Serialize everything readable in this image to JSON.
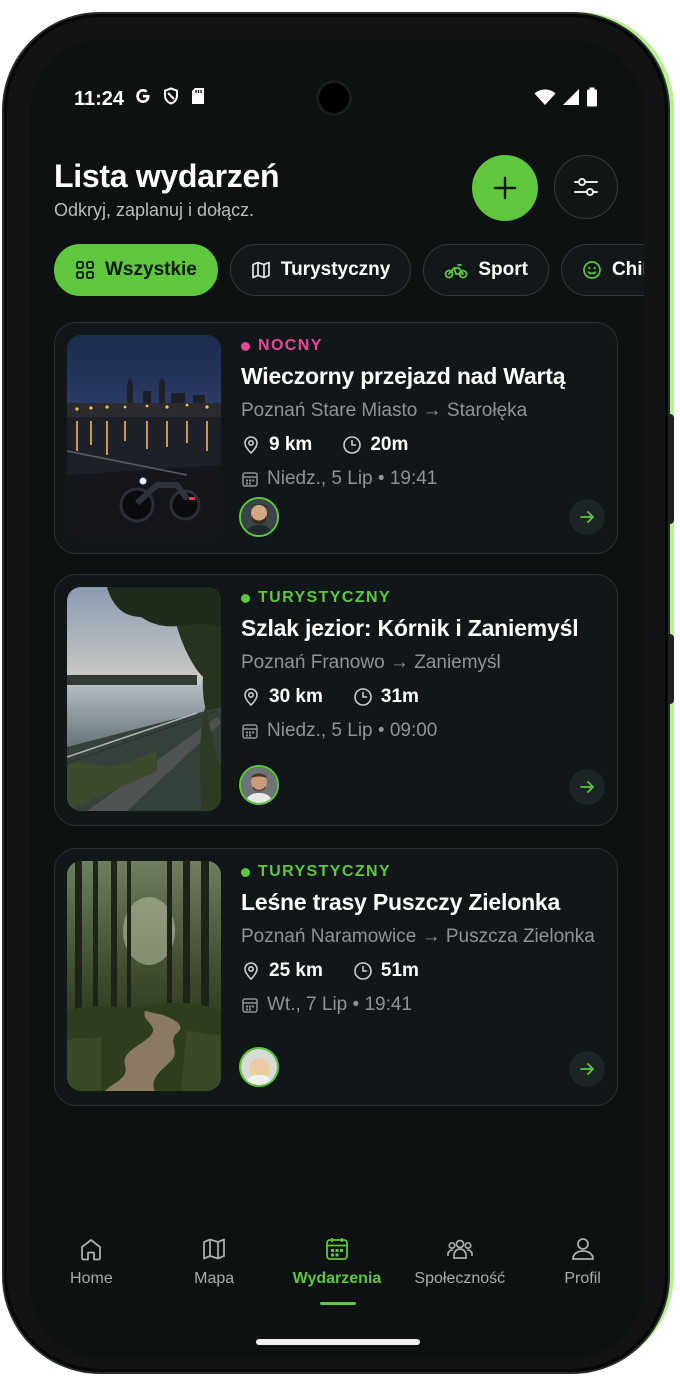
{
  "status_bar": {
    "time": "11:24"
  },
  "header": {
    "title": "Lista wydarzeń",
    "subtitle": "Odkryj, zaplanuj i dołącz."
  },
  "filters": [
    {
      "label": "Wszystkie",
      "icon": "grid-icon",
      "active": true
    },
    {
      "label": "Turystyczny",
      "icon": "map-icon",
      "active": false
    },
    {
      "label": "Sport",
      "icon": "motorcycle-icon",
      "active": false
    },
    {
      "label": "Chill",
      "icon": "smile-icon",
      "active": false
    }
  ],
  "events": [
    {
      "tag": "NOCNY",
      "tag_color": "#e8479a",
      "title": "Wieczorny przejazd nad Wartą",
      "route": "Poznań Stare Miasto → Starołęka",
      "distance": "9 km",
      "duration": "20m",
      "date": "Niedz., 5 Lip • 19:41"
    },
    {
      "tag": "TURYSTYCZNY",
      "tag_color": "#5ec73d",
      "title": "Szlak jezior: Kórnik i Zaniemyśl",
      "route": "Poznań Franowo → Zaniemyśl",
      "distance": "30 km",
      "duration": "31m",
      "date": "Niedz., 5 Lip • 09:00"
    },
    {
      "tag": "TURYSTYCZNY",
      "tag_color": "#5ec73d",
      "title": "Leśne trasy Puszczy Zielonka",
      "route": "Poznań Naramowice → Puszcza Zielonka",
      "distance": "25 km",
      "duration": "51m",
      "date": "Wt., 7 Lip • 19:41"
    }
  ],
  "nav": [
    {
      "label": "Home",
      "icon": "home-icon"
    },
    {
      "label": "Mapa",
      "icon": "map-icon"
    },
    {
      "label": "Wydarzenia",
      "icon": "calendar-icon",
      "active": true
    },
    {
      "label": "Społeczność",
      "icon": "community-icon"
    },
    {
      "label": "Profil",
      "icon": "profile-icon"
    }
  ],
  "colors": {
    "accent": "#5ec73d",
    "background": "#0d1112",
    "card": "#111718",
    "night_tag": "#e8479a"
  }
}
